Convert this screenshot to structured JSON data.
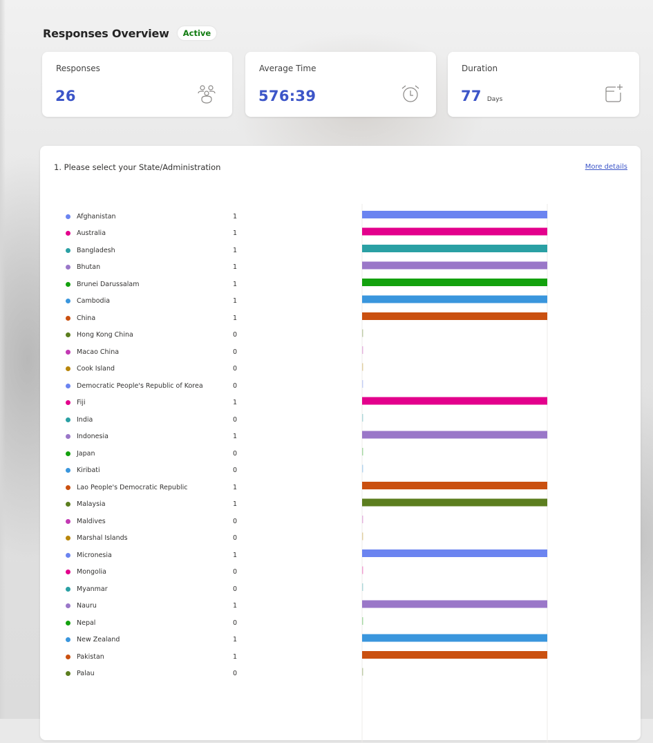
{
  "overview": {
    "title": "Responses Overview",
    "status": "Active"
  },
  "stats": {
    "responses": {
      "label": "Responses",
      "value": "26",
      "icon": "people-icon"
    },
    "average_time": {
      "label": "Average Time",
      "value": "576:39",
      "icon": "alarm-clock-icon"
    },
    "duration": {
      "label": "Duration",
      "value": "77",
      "unit": "Days",
      "icon": "calendar-sparkle-icon"
    }
  },
  "question": {
    "title": "1. Please select your State/Administration",
    "more_details": "More details"
  },
  "chart_data": {
    "type": "bar",
    "orientation": "horizontal",
    "categories": [
      "Afghanistan",
      "Australia",
      "Bangladesh",
      "Bhutan",
      "Brunei Darussalam",
      "Cambodia",
      "China",
      "Hong Kong China",
      "Macao China",
      "Cook Island",
      "Democratic People's Republic of Korea",
      "Fiji",
      "India",
      "Indonesia",
      "Japan",
      "Kiribati",
      "Lao People's Democratic Republic",
      "Malaysia",
      "Maldives",
      "Marshal Islands",
      "Micronesia",
      "Mongolia",
      "Myanmar",
      "Nauru",
      "Nepal",
      "New Zealand",
      "Pakistan",
      "Palau"
    ],
    "values": [
      1,
      1,
      1,
      1,
      1,
      1,
      1,
      0,
      0,
      0,
      0,
      1,
      0,
      1,
      0,
      0,
      1,
      1,
      0,
      0,
      1,
      0,
      0,
      1,
      0,
      1,
      1,
      0
    ],
    "value_max": 1,
    "colors": [
      "#6b84f0",
      "#e3008c",
      "#2aa0a4",
      "#9a77c8",
      "#13a10e",
      "#3a96dd",
      "#ca5010",
      "#5c7e1f",
      "#c239b3",
      "#b8860b"
    ],
    "legend": "left",
    "grid": false
  }
}
